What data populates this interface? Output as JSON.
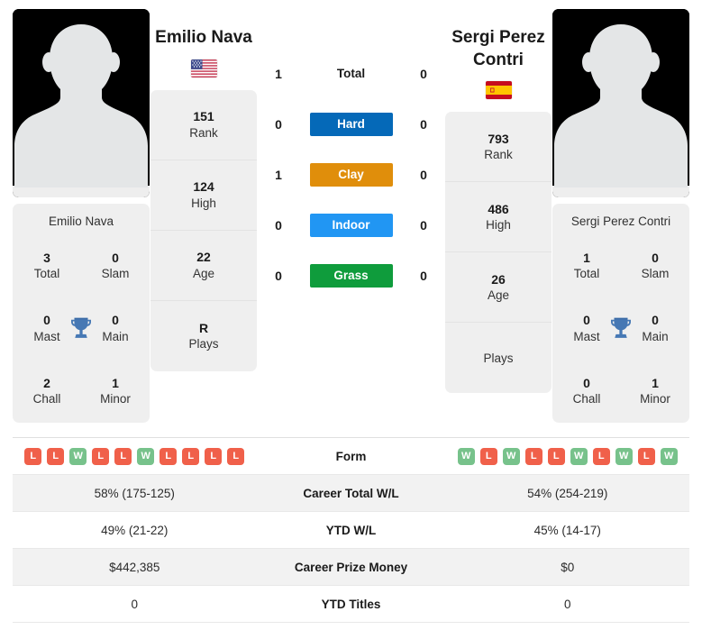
{
  "colors": {
    "hard": "#0569b8",
    "clay": "#e08e0b",
    "indoor": "#2196f3",
    "grass": "#0f9c3c",
    "win": "#77c28b",
    "loss": "#f0604a",
    "trophy": "#4678b4"
  },
  "players": {
    "left": {
      "name": "Emilio Nava",
      "flag": "us-flag-icon",
      "flag_title": "United States",
      "avatar": "player-photo-placeholder",
      "rank": {
        "value": "151",
        "label": "Rank"
      },
      "high": {
        "value": "124",
        "label": "High"
      },
      "age": {
        "value": "22",
        "label": "Age"
      },
      "plays": {
        "value": "R",
        "label": "Plays"
      },
      "titles": {
        "name": "Emilio Nava",
        "total": {
          "value": "3",
          "label": "Total"
        },
        "slam": {
          "value": "0",
          "label": "Slam"
        },
        "mast": {
          "value": "0",
          "label": "Mast"
        },
        "main": {
          "value": "0",
          "label": "Main"
        },
        "chall": {
          "value": "2",
          "label": "Chall"
        },
        "minor": {
          "value": "1",
          "label": "Minor"
        }
      }
    },
    "right": {
      "name": "Sergi Perez Contri",
      "flag": "es-flag-icon",
      "flag_title": "Spain",
      "avatar": "player-photo-placeholder",
      "rank": {
        "value": "793",
        "label": "Rank"
      },
      "high": {
        "value": "486",
        "label": "High"
      },
      "age": {
        "value": "26",
        "label": "Age"
      },
      "plays": {
        "value": "",
        "label": "Plays"
      },
      "titles": {
        "name": "Sergi Perez Contri",
        "total": {
          "value": "1",
          "label": "Total"
        },
        "slam": {
          "value": "0",
          "label": "Slam"
        },
        "mast": {
          "value": "0",
          "label": "Mast"
        },
        "main": {
          "value": "0",
          "label": "Main"
        },
        "chall": {
          "value": "0",
          "label": "Chall"
        },
        "minor": {
          "value": "1",
          "label": "Minor"
        }
      }
    }
  },
  "head_to_head": [
    {
      "label": "Total",
      "left": "1",
      "right": "0",
      "style": "plain"
    },
    {
      "label": "Hard",
      "left": "0",
      "right": "0",
      "style": "hard"
    },
    {
      "label": "Clay",
      "left": "1",
      "right": "0",
      "style": "clay"
    },
    {
      "label": "Indoor",
      "left": "0",
      "right": "0",
      "style": "indoor"
    },
    {
      "label": "Grass",
      "left": "0",
      "right": "0",
      "style": "grass"
    }
  ],
  "stats": {
    "form": {
      "label": "Form",
      "left": [
        "L",
        "L",
        "W",
        "L",
        "L",
        "W",
        "L",
        "L",
        "L",
        "L"
      ],
      "right": [
        "W",
        "L",
        "W",
        "L",
        "L",
        "W",
        "L",
        "W",
        "L",
        "W"
      ]
    },
    "rows": [
      {
        "label": "Career Total W/L",
        "left": "58% (175-125)",
        "right": "54% (254-219)"
      },
      {
        "label": "YTD W/L",
        "left": "49% (21-22)",
        "right": "45% (14-17)"
      },
      {
        "label": "Career Prize Money",
        "left": "$442,385",
        "right": "$0"
      },
      {
        "label": "YTD Titles",
        "left": "0",
        "right": "0"
      }
    ]
  }
}
